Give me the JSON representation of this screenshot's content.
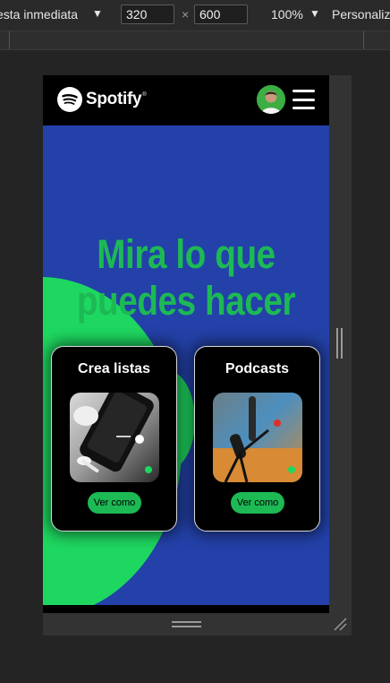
{
  "toolbar": {
    "device": "esta inmediata",
    "width_value": "320",
    "height_value": "600",
    "times_symbol": "×",
    "zoom": "100%",
    "customize": "Personaliz",
    "dropdown_arrow": "▼"
  },
  "site": {
    "brand": "Spotify",
    "brand_tm": "®",
    "accent": "#1db954",
    "hero_bg": "#2341a8",
    "headline": "Mira lo que puedes hacer",
    "cards": [
      {
        "title": "Crea listas",
        "button": "Ver como"
      },
      {
        "title": "Podcasts",
        "button": "Ver como"
      }
    ]
  },
  "icons": {
    "logo": "spotify-logo-icon",
    "avatar": "user-avatar",
    "menu": "hamburger-menu-icon"
  }
}
